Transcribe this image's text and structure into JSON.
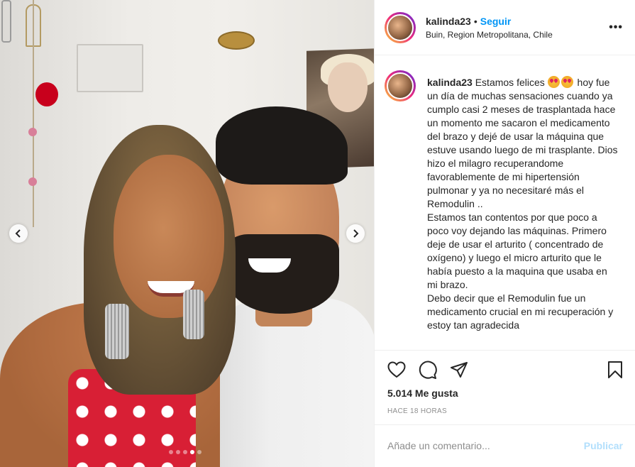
{
  "post": {
    "username": "kalinda23",
    "separator": "•",
    "follow_label": "Seguir",
    "location": "Buin, Region Metropolitana, Chile",
    "more_label": "•••"
  },
  "caption": {
    "username": "kalinda23",
    "intro": "Estamos felices",
    "text": "hoy fue un día de muchas sensaciones cuando ya cumplo casi 2 meses de trasplantada hace un momento me sacaron el medicamento del brazo y dejé de usar la máquina que estuve usando luego de mi trasplante. Dios hizo el milagro recuperandome favorablemente de mi hipertensión pulmonar y ya no necesitaré más el Remodulin ..",
    "paragraph2": "Estamos tan contentos por que poco a poco voy dejando las máquinas. Primero deje de usar el arturito ( concentrado de oxígeno) y luego el micro arturito que le había puesto a la maquina que usaba en mi brazo.",
    "paragraph3": "Debo decir que el Remodulin fue un medicamento crucial en mi recuperación y estoy tan agradecida"
  },
  "stats": {
    "likes": "5.014 Me gusta",
    "time": "HACE 18 HORAS"
  },
  "comment": {
    "placeholder": "Añade un comentario...",
    "publish_label": "Publicar"
  },
  "carousel": {
    "slide_count": 5,
    "active_index": 3
  },
  "icons": {
    "like": "heart-icon",
    "comment": "comment-icon",
    "share": "share-icon",
    "save": "bookmark-icon",
    "prev": "chevron-left-icon",
    "next": "chevron-right-icon"
  },
  "colors": {
    "link": "#0095f6",
    "publish_disabled": "#b2dffc",
    "muted": "#8e8e8e"
  }
}
